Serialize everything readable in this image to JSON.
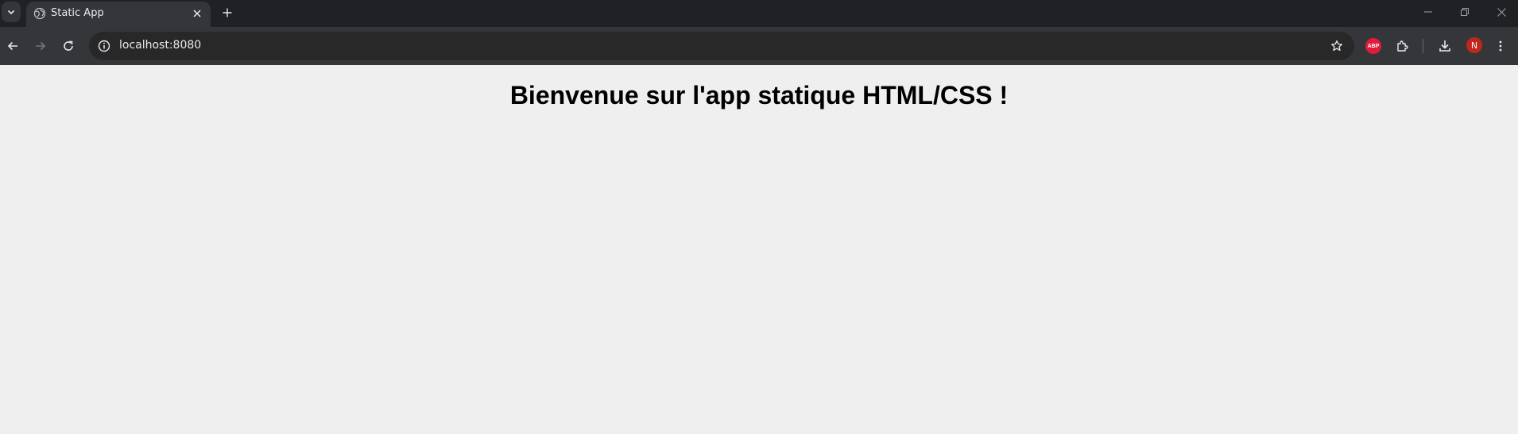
{
  "tabstrip": {
    "tabs": [
      {
        "title": "Static App",
        "favicon": "globe-icon",
        "active": true
      }
    ]
  },
  "toolbar": {
    "url": "localhost:8080",
    "abp_label": "ABP",
    "profile_initial": "N"
  },
  "page": {
    "heading": "Bienvenue sur l'app statique HTML/CSS !"
  },
  "colors": {
    "tabstrip_bg": "#202124",
    "toolbar_bg": "#35363a",
    "omnibox_bg": "#282828",
    "page_bg": "#efefef",
    "abp_red": "#e21b3a",
    "avatar_red": "#c0271a"
  }
}
